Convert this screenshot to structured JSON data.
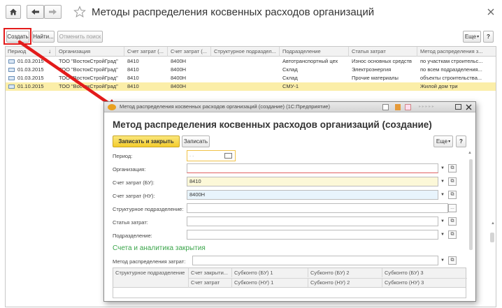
{
  "main": {
    "title": "Методы распределения косвенных расходов организаций",
    "toolbar": {
      "create": "Создать",
      "find": "Найти...",
      "cancel_search": "Отменить поиск",
      "more": "Еще",
      "help": "?"
    },
    "table": {
      "columns": [
        "Период",
        "Организация",
        "Счет затрат (...",
        "Счет затрат (...",
        "Структурное подраздел...",
        "Подразделение",
        "Статья затрат",
        "Метод распределения з..."
      ],
      "sort_indicator": "↓",
      "rows": [
        [
          "01.03.2015",
          "ТОО \"ВостокСтройГрад\"",
          "8410",
          "8400Н",
          "",
          "Автотранспортный цех",
          "Износ основных средств",
          "по участкам строительс..."
        ],
        [
          "01.03.2015",
          "ТОО \"ВостокСтройГрад\"",
          "8410",
          "8400Н",
          "",
          "Склад",
          "Электроэнергия",
          "по всем подразделения..."
        ],
        [
          "01.03.2015",
          "ТОО \"ВостокСтройГрад\"",
          "8410",
          "8400Н",
          "",
          "Склад",
          "Прочие материалы",
          "объекты строительства..."
        ],
        [
          "01.10.2015",
          "ТОО \"ВостокСтройГрад\"",
          "8410",
          "8400Н",
          "",
          "СМУ-1",
          "",
          "Жилой дом три"
        ]
      ],
      "selected_row": 3
    }
  },
  "dialog": {
    "window_title": "Метод распределения косвенных расходов организаций (создание) (1С:Предприятие)",
    "heading": "Метод распределения косвенных расходов организаций (создание)",
    "save_close": "Записать и закрыть",
    "save": "Записать",
    "more": "Еще",
    "help": "?",
    "fields": {
      "period_label": "Период:",
      "period_value": ". .",
      "org_label": "Организация:",
      "org_value": "",
      "acc_bu_label": "Счет затрат (БУ):",
      "acc_bu_value": "8410",
      "acc_nu_label": "Счет затрат (НУ):",
      "acc_nu_value": "8400Н",
      "struct_label": "Структурное подразделение:",
      "struct_value": "",
      "cost_item_label": "Статья затрат:",
      "cost_item_value": "",
      "dept_label": "Подразделение:",
      "dept_value": ""
    },
    "section_title": "Счета и аналитика закрытия",
    "method_label": "Метод распределения затрат:",
    "method_value": "",
    "subtable": {
      "header1": [
        "Структурное подразделение",
        "Счет закрыти...",
        "Субконто (БУ) 1",
        "Субконто (БУ) 2",
        "Субконто (БУ) 3"
      ],
      "header2": [
        "Счет затрат",
        "Субконто (НУ) 1",
        "Субконто (НУ) 2",
        "Субконто (НУ) 3"
      ]
    }
  },
  "colors": {
    "highlight_red": "#e31b1b",
    "section_green": "#3aa54a",
    "selected_row": "#fbeea8",
    "save_button": "#f6d84a"
  }
}
